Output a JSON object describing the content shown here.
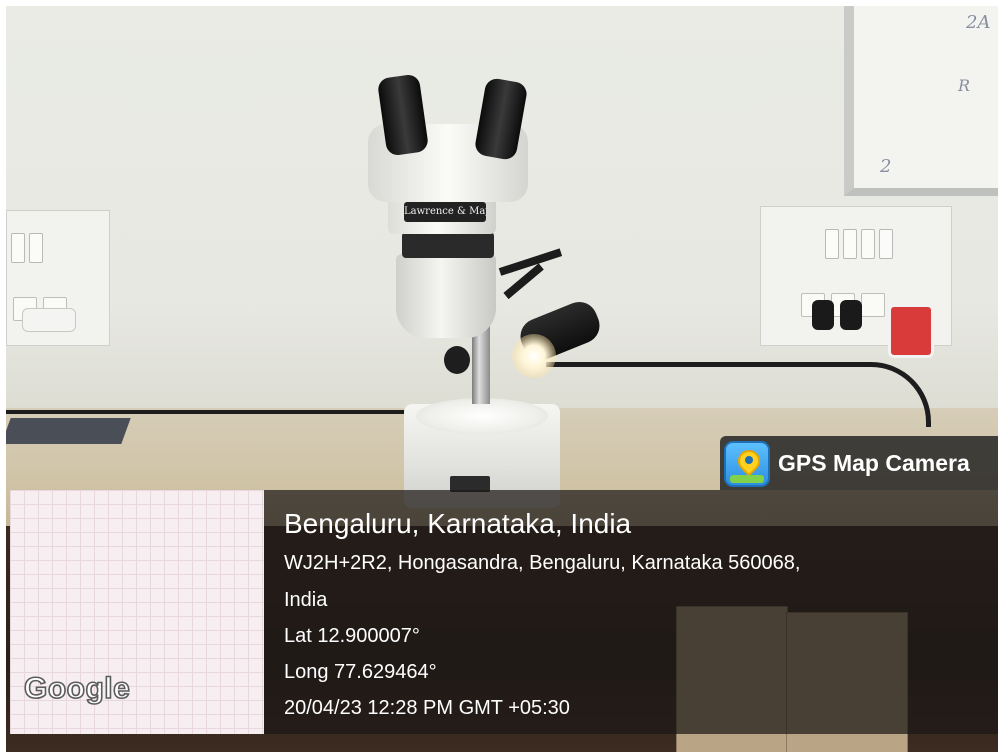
{
  "photo": {
    "subject": "stereo microscope on desk",
    "microscope_brand_plate": "Lawrence & Mayo"
  },
  "overlay": {
    "app_name": "GPS Map Camera",
    "app_icon": "map-pin-icon",
    "map_attribution": "Google",
    "location_title": "Bengaluru, Karnataka, India",
    "address_line_1": "WJ2H+2R2, Hongasandra, Bengaluru, Karnataka 560068,",
    "address_line_2": "India",
    "latitude": "Lat 12.900007°",
    "longitude": "Long 77.629464°",
    "timestamp": "20/04/23 12:28 PM GMT +05:30"
  },
  "whiteboard": {
    "scribble_1": "2A",
    "scribble_2": "R",
    "scribble_3": "2"
  },
  "colors": {
    "overlay_panel": "#1c1816",
    "map_tile": "#f7eef1",
    "icon_blue": "#2d8fe0",
    "icon_pin": "#ffd21f"
  }
}
